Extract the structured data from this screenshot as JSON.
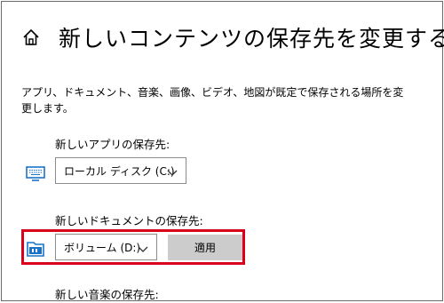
{
  "header": {
    "title": "新しいコンテンツの保存先を変更する",
    "home_icon": "home-icon"
  },
  "description": "アプリ、ドキュメント、音楽、画像、ビデオ、地図が既定で保存される場所を変更します。",
  "sections": [
    {
      "label": "新しいアプリの保存先:",
      "icon": "monitor-icon",
      "selected": "ローカル ディスク (C:)"
    },
    {
      "label": "新しいドキュメントの保存先:",
      "icon": "drive-icon",
      "selected": "ボリューム (D:)",
      "apply_label": "適用"
    },
    {
      "label": "新しい音楽の保存先:"
    }
  ],
  "colors": {
    "highlight": "#d9001b",
    "icon_blue": "#1a73c8",
    "button_bg": "#cccccc"
  }
}
